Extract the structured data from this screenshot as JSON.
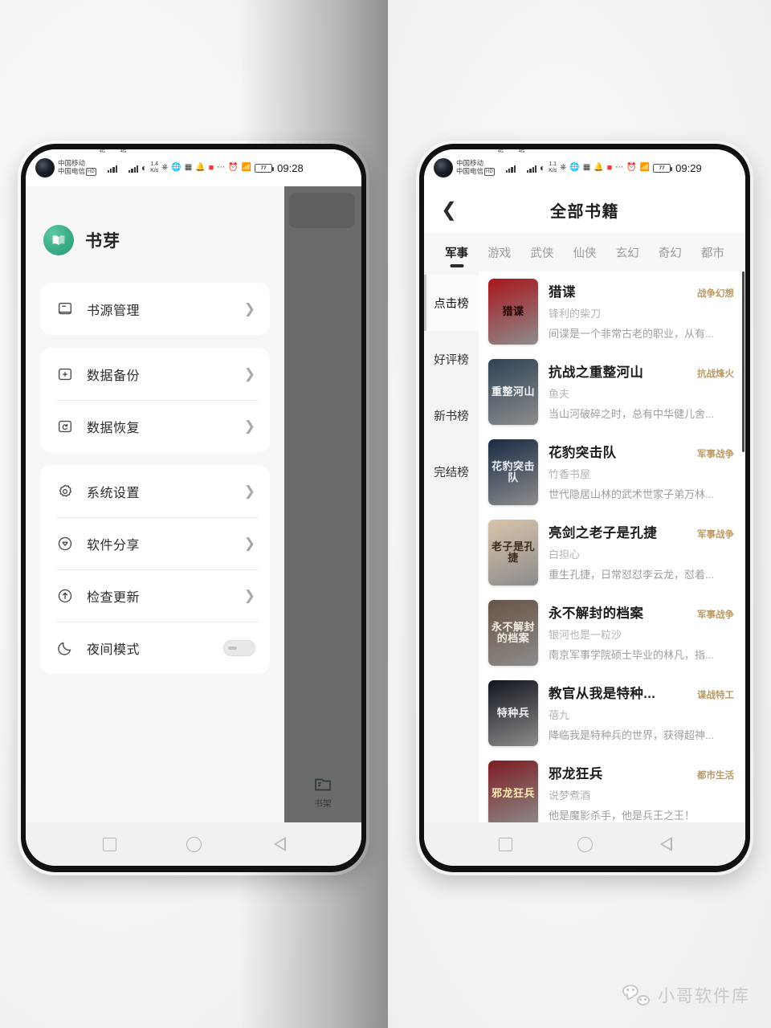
{
  "watermark": {
    "text": "小哥软件库",
    "icon": "wechat-icon"
  },
  "left_phone": {
    "statusbar": {
      "carrier1": "中国移动",
      "carrier2": "中国电信",
      "hd_badge": "HD",
      "net1": "4G",
      "net2": "4G",
      "speed_value": "1.4",
      "speed_unit": "K/s",
      "battery": "77",
      "clock": "09:28",
      "icons": [
        "vpn-icon",
        "globe-icon",
        "nfc-icon",
        "bell-icon",
        "stop-square-icon",
        "more-icon",
        "alarm-icon",
        "bluetooth-icon"
      ]
    },
    "brand": {
      "name": "书芽",
      "logo": "book-sprout-logo"
    },
    "groups": [
      {
        "items": [
          {
            "label": "书源管理",
            "icon": "book-source-icon",
            "control": "chevron"
          }
        ]
      },
      {
        "items": [
          {
            "label": "数据备份",
            "icon": "plus-box-icon",
            "control": "chevron"
          },
          {
            "label": "数据恢复",
            "icon": "restore-box-icon",
            "control": "chevron"
          }
        ]
      },
      {
        "items": [
          {
            "label": "系统设置",
            "icon": "gear-icon",
            "control": "chevron"
          },
          {
            "label": "软件分享",
            "icon": "share-icon",
            "control": "chevron"
          },
          {
            "label": "检查更新",
            "icon": "arrow-up-circle-icon",
            "control": "chevron"
          },
          {
            "label": "夜间模式",
            "icon": "moon-icon",
            "control": "toggle",
            "toggle_on": false
          }
        ]
      }
    ],
    "shelf_tab": {
      "label": "书架",
      "icon": "bookshelf-icon"
    },
    "navbar": [
      "recents-square-icon",
      "home-circle-icon",
      "back-triangle-icon"
    ]
  },
  "right_phone": {
    "statusbar": {
      "carrier1": "中国移动",
      "carrier2": "中国电信",
      "hd_badge": "HD",
      "net1": "4G",
      "net2": "4G",
      "speed_value": "1.1",
      "speed_unit": "K/s",
      "battery": "77",
      "clock": "09:29",
      "icons": [
        "vpn-icon",
        "globe-icon",
        "nfc-icon",
        "bell-icon",
        "stop-square-icon",
        "more-icon",
        "alarm-icon",
        "bluetooth-icon"
      ]
    },
    "appbar": {
      "title": "全部书籍",
      "back_icon": "chevron-left-icon"
    },
    "category_tabs": [
      {
        "label": "军事",
        "active": true
      },
      {
        "label": "游戏",
        "active": false
      },
      {
        "label": "武侠",
        "active": false
      },
      {
        "label": "仙侠",
        "active": false
      },
      {
        "label": "玄幻",
        "active": false
      },
      {
        "label": "奇幻",
        "active": false
      },
      {
        "label": "都市",
        "active": false
      }
    ],
    "rank_rail": [
      {
        "label": "点击榜",
        "active": true
      },
      {
        "label": "好评榜",
        "active": false
      },
      {
        "label": "新书榜",
        "active": false
      },
      {
        "label": "完结榜",
        "active": false
      }
    ],
    "books": [
      {
        "title": "猎谍",
        "tag": "战争幻想",
        "author": "锋利的柴刀",
        "desc": "间谍是一个非常古老的职业，从有...",
        "cover_text": "猎谍",
        "cover_bg": "#a8161c",
        "cover_fg": "#1a0506"
      },
      {
        "title": "抗战之重整河山",
        "tag": "抗战烽火",
        "author": "鱼夫",
        "desc": "当山河破碎之时，总有中华健儿舍...",
        "cover_text": "重整河山",
        "cover_bg": "#2e4356",
        "cover_fg": "#f2f4f7"
      },
      {
        "title": "花豹突击队",
        "tag": "军事战争",
        "author": "竹香书屋",
        "desc": "世代隐居山林的武术世家子弟万林...",
        "cover_text": "花豹突击队",
        "cover_bg": "#1a2b44",
        "cover_fg": "#e9f1fb"
      },
      {
        "title": "亮剑之老子是孔捷",
        "tag": "军事战争",
        "author": "白担心",
        "desc": "重生孔捷，日常怼怼李云龙，怼着...",
        "cover_text": "老子是孔捷",
        "cover_bg": "#d9c4ab",
        "cover_fg": "#3c2a1b"
      },
      {
        "title": "永不解封的档案",
        "tag": "军事战争",
        "author": "银河也是一粒沙",
        "desc": "南京军事学院硕士毕业的林凡，指...",
        "cover_text": "永不解封的档案",
        "cover_bg": "#6a5444",
        "cover_fg": "#f6efe6"
      },
      {
        "title": "教官从我是特种...",
        "tag": "谍战特工",
        "author": "蓓九",
        "desc": "降临我是特种兵的世界，获得超神...",
        "cover_text": "特种兵",
        "cover_bg": "#11151c",
        "cover_fg": "#f0f4fa"
      },
      {
        "title": "邪龙狂兵",
        "tag": "都市生活",
        "author": "说梦煮酒",
        "desc": "他是魔影杀手，他是兵王之王！",
        "cover_text": "邪龙狂兵",
        "cover_bg": "#7d1d22",
        "cover_fg": "#ffe9b0"
      }
    ],
    "navbar": [
      "recents-square-icon",
      "home-circle-icon",
      "back-triangle-icon"
    ]
  }
}
